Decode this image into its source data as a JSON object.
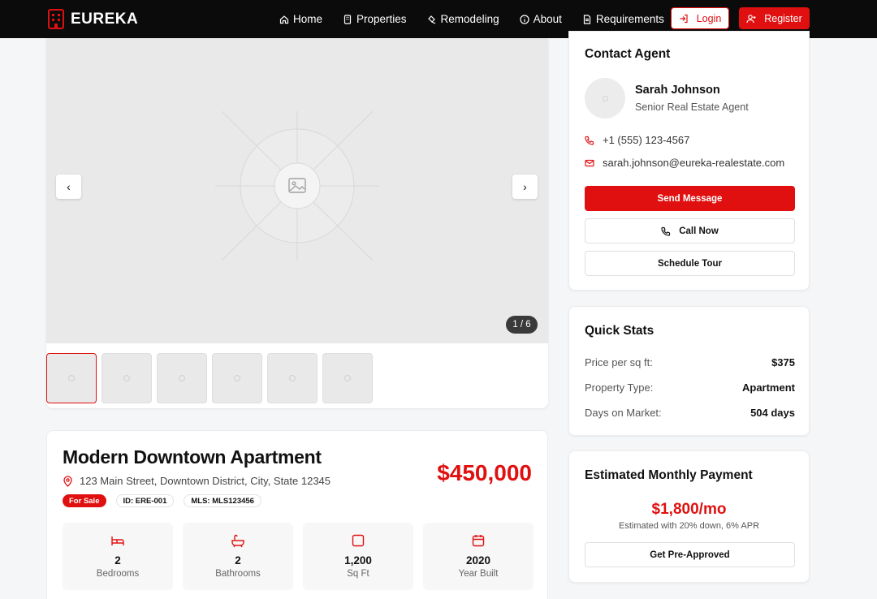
{
  "nav": {
    "brand": "EUREKA",
    "links": [
      {
        "label": "Home",
        "icon": "home-icon"
      },
      {
        "label": "Properties",
        "icon": "building-icon"
      },
      {
        "label": "Remodeling",
        "icon": "hammer-icon"
      },
      {
        "label": "About",
        "icon": "info-icon"
      },
      {
        "label": "Requirements",
        "icon": "document-icon"
      }
    ],
    "login": "Login",
    "register": "Register"
  },
  "gallery": {
    "counter": "1 / 6",
    "thumb_count": 6
  },
  "property": {
    "title": "Modern Downtown Apartment",
    "address": "123 Main Street, Downtown District, City, State 12345",
    "price": "$450,000",
    "badges": [
      "For Sale",
      "ID: ERE-001",
      "MLS: MLS123456"
    ],
    "stats": [
      {
        "value": "2",
        "label": "Bedrooms",
        "icon": "bed-icon"
      },
      {
        "value": "2",
        "label": "Bathrooms",
        "icon": "bath-icon"
      },
      {
        "value": "1,200",
        "label": "Sq Ft",
        "icon": "square-icon"
      },
      {
        "value": "2020",
        "label": "Year Built",
        "icon": "calendar-icon"
      }
    ]
  },
  "contact": {
    "heading": "Contact Agent",
    "name": "Sarah Johnson",
    "role": "Senior Real Estate Agent",
    "phone": "+1 (555) 123-4567",
    "email": "sarah.johnson@eureka-realestate.com",
    "send": "Send Message",
    "call": "Call Now",
    "schedule": "Schedule Tour"
  },
  "quick_stats": {
    "heading": "Quick Stats",
    "rows": [
      {
        "key": "Price per sq ft:",
        "value": "$375"
      },
      {
        "key": "Property Type:",
        "value": "Apartment"
      },
      {
        "key": "Days on Market:",
        "value": "504 days"
      }
    ]
  },
  "monthly": {
    "heading": "Estimated Monthly Payment",
    "amount": "$1,800/mo",
    "note": "Estimated with 20% down, 6% APR",
    "button": "Get Pre-Approved"
  },
  "colors": {
    "accent": "#e01010",
    "nav_bg": "#0b0b0b"
  }
}
